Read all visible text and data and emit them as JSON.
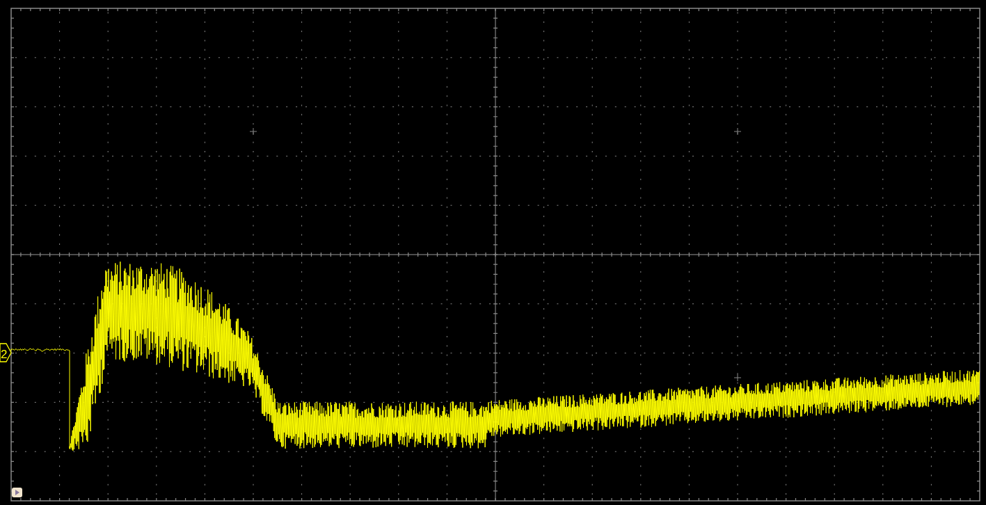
{
  "channel_marker": {
    "label": "2"
  }
}
